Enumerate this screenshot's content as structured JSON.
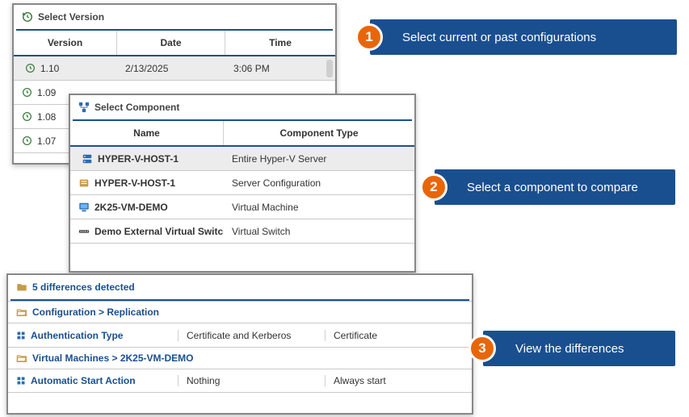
{
  "panel_version": {
    "title": "Select Version",
    "cols": {
      "c1": "Version",
      "c2": "Date",
      "c3": "Time"
    },
    "rows": [
      {
        "version": "1.10",
        "date": "2/13/2025",
        "time": "3:06 PM",
        "selected": true
      },
      {
        "version": "1.09",
        "date": "",
        "time": ""
      },
      {
        "version": "1.08",
        "date": "",
        "time": ""
      },
      {
        "version": "1.07",
        "date": "",
        "time": ""
      }
    ]
  },
  "panel_component": {
    "title": "Select Component",
    "cols": {
      "c1": "Name",
      "c2": "Component Type"
    },
    "rows": [
      {
        "name": "HYPER-V-HOST-1",
        "type": "Entire Hyper-V Server",
        "selected": true,
        "icon": "server"
      },
      {
        "name": "HYPER-V-HOST-1",
        "type": "Server Configuration",
        "selected": false,
        "icon": "config"
      },
      {
        "name": "2K25-VM-DEMO",
        "type": "Virtual Machine",
        "selected": false,
        "icon": "vm"
      },
      {
        "name": "Demo External Virtual Switch",
        "type": "Virtual Switch",
        "selected": false,
        "icon": "switch"
      }
    ]
  },
  "panel_diff": {
    "title": "5 differences detected",
    "group1": "Configuration > Replication",
    "row1": {
      "label": "Authentication Type",
      "a": "Certificate and Kerberos",
      "b": "Certificate"
    },
    "group2": "Virtual Machines > 2K25-VM-DEMO",
    "row2": {
      "label": "Automatic Start Action",
      "a": "Nothing",
      "b": "Always start"
    }
  },
  "callouts": {
    "c1": {
      "num": "1",
      "text": "Select current or past configurations"
    },
    "c2": {
      "num": "2",
      "text": "Select a component to compare"
    },
    "c3": {
      "num": "3",
      "text": "View the differences"
    }
  }
}
